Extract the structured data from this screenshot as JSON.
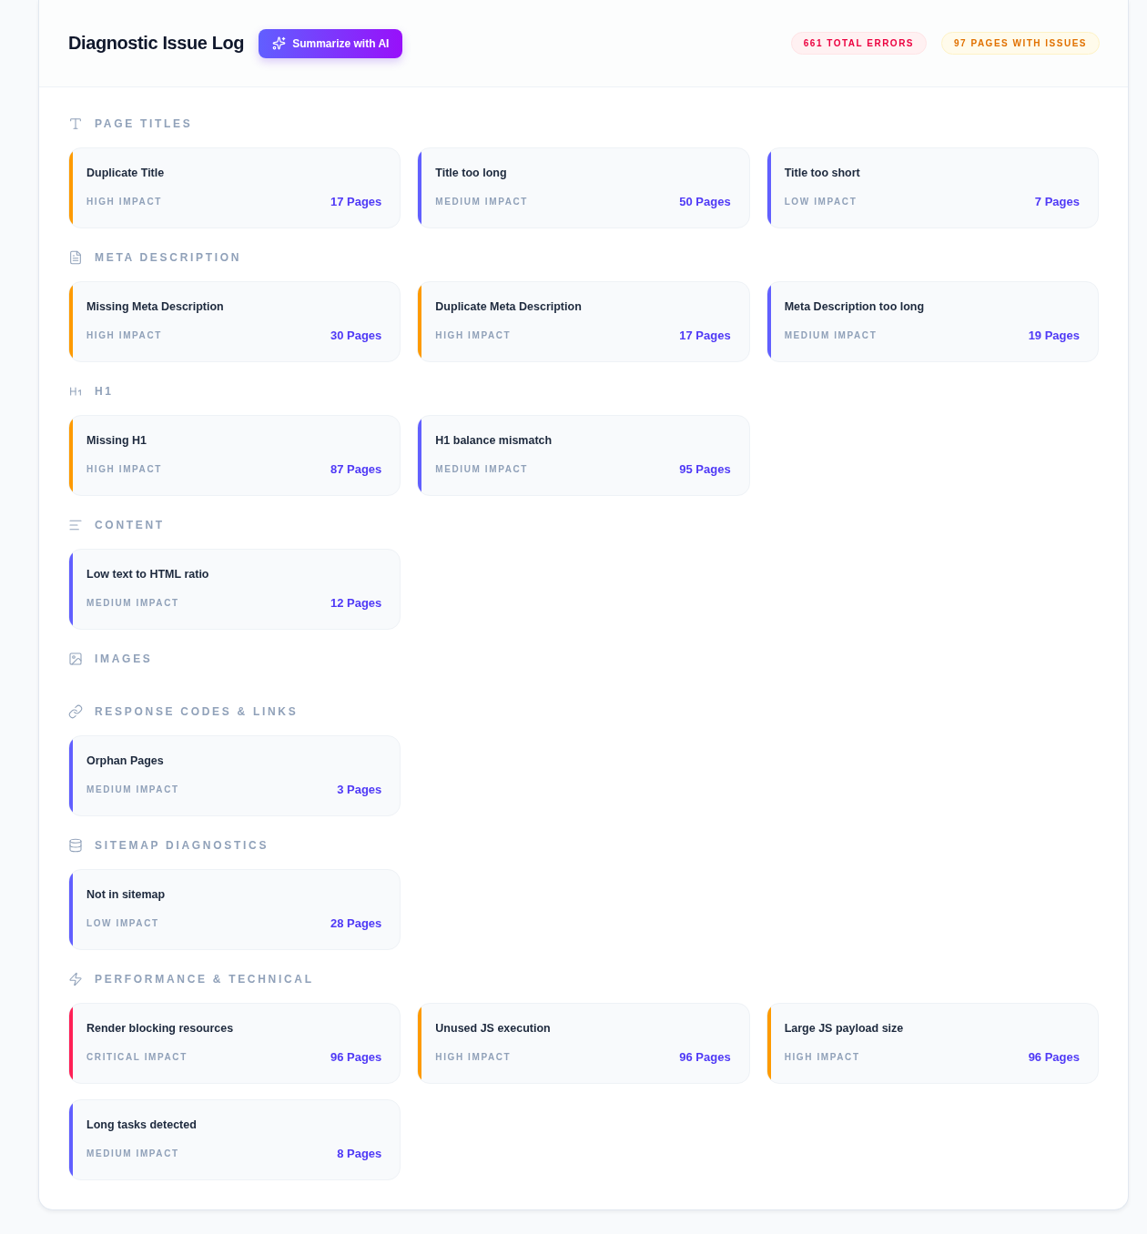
{
  "header": {
    "title": "Diagnostic Issue Log",
    "action": {
      "label": "Summarize with AI"
    },
    "badges": [
      {
        "kind": "error",
        "label": "661 TOTAL ERRORS"
      },
      {
        "kind": "warning",
        "label": "97 PAGES WITH ISSUES"
      }
    ]
  },
  "sections": [
    {
      "kind": "titles",
      "title": "PAGE TITLES",
      "issues": [
        {
          "title": "Duplicate Title",
          "impact": "HIGH IMPACT",
          "pages": "17 Pages",
          "color": "#fe9a00"
        },
        {
          "title": "Title too long",
          "impact": "MEDIUM IMPACT",
          "pages": "50 Pages",
          "color": "#615fff"
        },
        {
          "title": "Title too short",
          "impact": "LOW IMPACT",
          "pages": "7 Pages",
          "color": "#615fff"
        }
      ]
    },
    {
      "kind": "meta",
      "title": "META DESCRIPTION",
      "issues": [
        {
          "title": "Missing Meta Description",
          "impact": "HIGH IMPACT",
          "pages": "30 Pages",
          "color": "#fe9a00"
        },
        {
          "title": "Duplicate Meta Description",
          "impact": "HIGH IMPACT",
          "pages": "17 Pages",
          "color": "#fe9a00"
        },
        {
          "title": "Meta Description too long",
          "impact": "MEDIUM IMPACT",
          "pages": "19 Pages",
          "color": "#615fff"
        }
      ]
    },
    {
      "kind": "headings",
      "title": "H1",
      "issues": [
        {
          "title": "Missing H1",
          "impact": "HIGH IMPACT",
          "pages": "87 Pages",
          "color": "#fe9a00"
        },
        {
          "title": "H1 balance mismatch",
          "impact": "MEDIUM IMPACT",
          "pages": "95 Pages",
          "color": "#615fff"
        }
      ]
    },
    {
      "kind": "content",
      "title": "CONTENT",
      "issues": [
        {
          "title": "Low text to HTML ratio",
          "impact": "MEDIUM IMPACT",
          "pages": "12 Pages",
          "color": "#615fff"
        }
      ]
    },
    {
      "kind": "images",
      "title": "IMAGES"
    },
    {
      "kind": "links",
      "title": "RESPONSE CODES & LINKS",
      "issues": [
        {
          "title": "Orphan Pages",
          "impact": "MEDIUM IMPACT",
          "pages": "3 Pages",
          "color": "#615fff"
        }
      ]
    },
    {
      "kind": "sitemap",
      "title": "SITEMAP DIAGNOSTICS",
      "issues": [
        {
          "title": "Not in sitemap",
          "impact": "LOW IMPACT",
          "pages": "28 Pages",
          "color": "#615fff"
        }
      ]
    },
    {
      "kind": "performance",
      "title": "PERFORMANCE & TECHNICAL",
      "issues": [
        {
          "title": "Render blocking resources",
          "impact": "CRITICAL IMPACT",
          "pages": "96 Pages",
          "color": "#ff2056"
        },
        {
          "title": "Unused JS execution",
          "impact": "HIGH IMPACT",
          "pages": "96 Pages",
          "color": "#fe9a00"
        },
        {
          "title": "Large JS payload size",
          "impact": "HIGH IMPACT",
          "pages": "96 Pages",
          "color": "#fe9a00"
        },
        {
          "title": "Long tasks detected",
          "impact": "MEDIUM IMPACT",
          "pages": "8 Pages",
          "color": "#615fff"
        }
      ]
    }
  ]
}
